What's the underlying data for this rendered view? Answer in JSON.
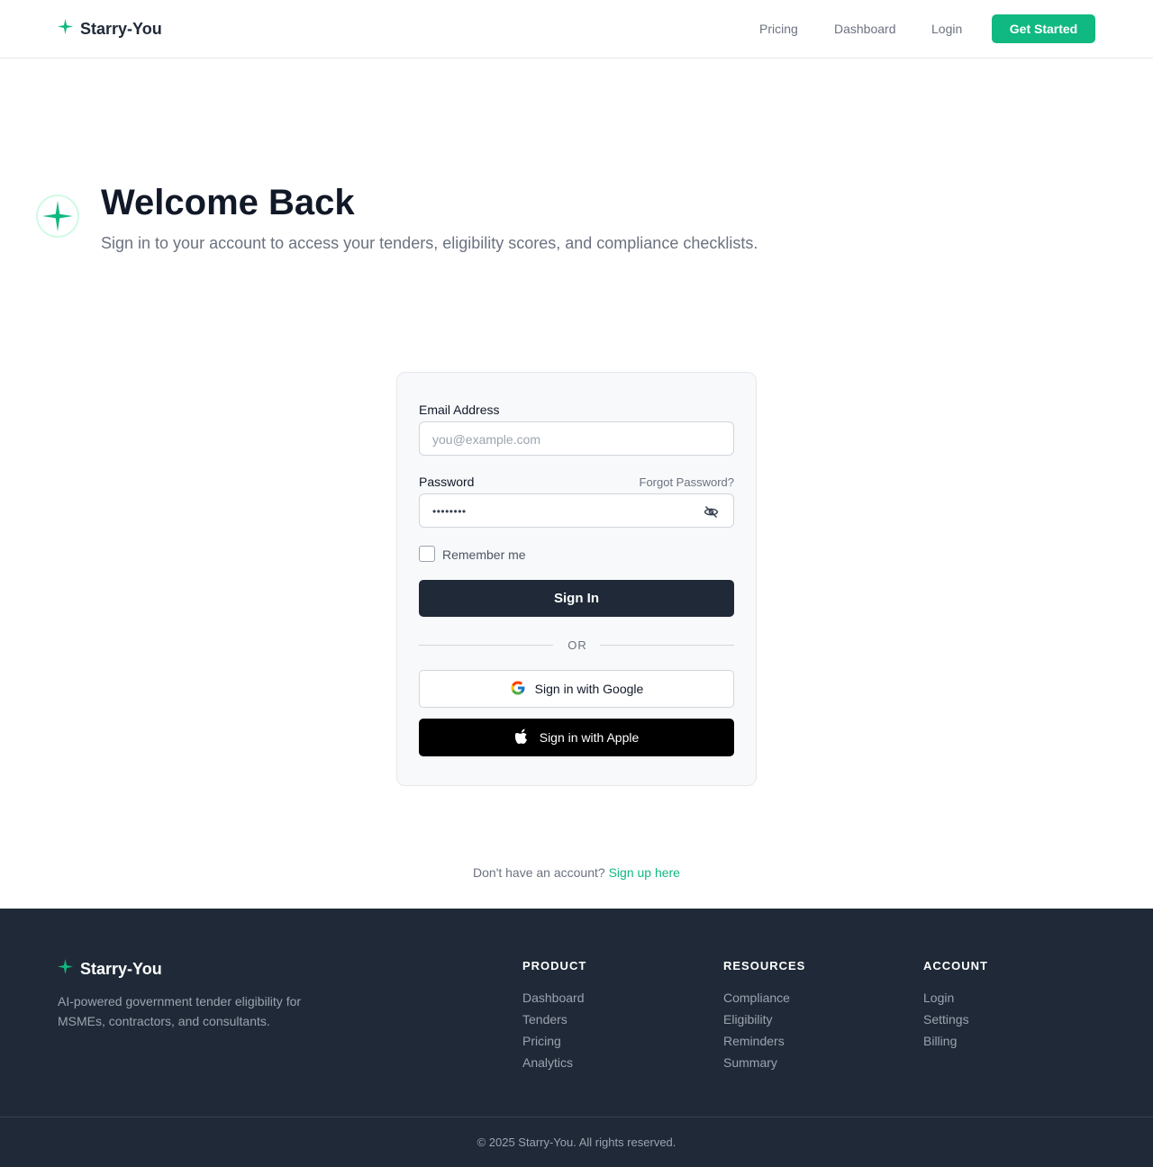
{
  "header": {
    "brand": "Starry-You",
    "nav": [
      "Pricing",
      "Dashboard",
      "Login"
    ],
    "cta": "Get Started"
  },
  "hero": {
    "title": "Welcome Back",
    "subtitle": "Sign in to your account to access your tenders, eligibility scores, and compliance checklists."
  },
  "form": {
    "email_label": "Email Address",
    "email_placeholder": "you@example.com",
    "password_label": "Password",
    "forgot": "Forgot Password?",
    "password_value": "••••••••",
    "remember": "Remember me",
    "signin": "Sign In",
    "or": "OR",
    "google": "Sign in with Google",
    "apple": "Sign in with Apple"
  },
  "signup": {
    "prompt": "Don't have an account?",
    "link": "Sign up here"
  },
  "footer": {
    "brand": "Starry-You",
    "description": "AI-powered government tender eligibility for MSMEs, contractors, and consultants.",
    "columns": [
      {
        "title": "PRODUCT",
        "links": [
          "Dashboard",
          "Tenders",
          "Pricing",
          "Analytics"
        ]
      },
      {
        "title": "RESOURCES",
        "links": [
          "Compliance",
          "Eligibility",
          "Reminders",
          "Summary"
        ]
      },
      {
        "title": "ACCOUNT",
        "links": [
          "Login",
          "Settings",
          "Billing"
        ]
      }
    ],
    "copyright": "© 2025 Starry-You. All rights reserved."
  },
  "colors": {
    "accent": "#10b981",
    "dark": "#1f2937",
    "muted": "#6b7280"
  },
  "icons": [
    "sparkle-icon",
    "eye-off-icon",
    "google-icon",
    "apple-icon"
  ]
}
